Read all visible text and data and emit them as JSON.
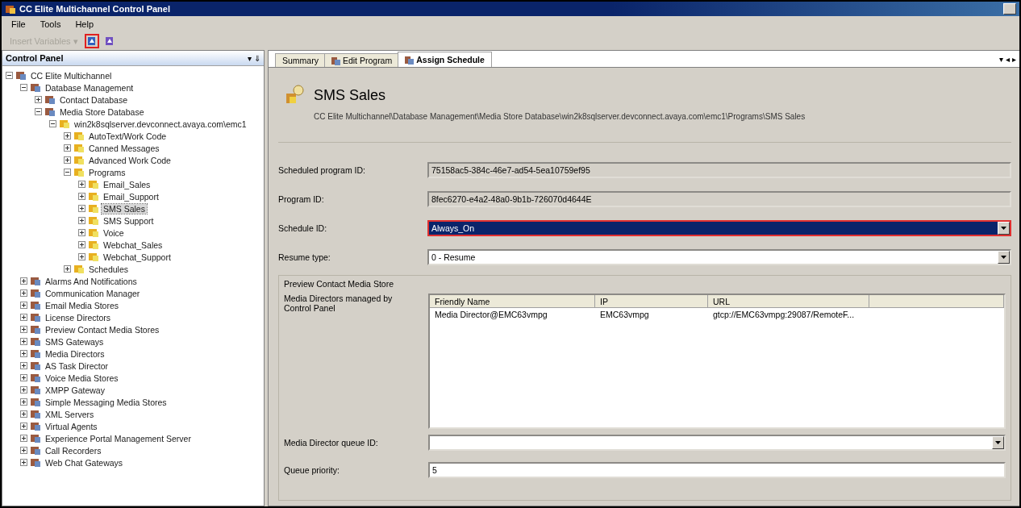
{
  "window": {
    "title": "CC Elite Multichannel Control Panel"
  },
  "menu": [
    "File",
    "Tools",
    "Help"
  ],
  "toolbar": {
    "insert_variables": {
      "label": "Insert Variables",
      "caret": "▾",
      "disabled": true
    },
    "icons": [
      {
        "highlighted": true
      },
      {
        "highlighted": false
      }
    ]
  },
  "tree_panel": {
    "title": "Control Panel",
    "pin": "▾ ⇓"
  },
  "tree": [
    {
      "label": "CC Elite Multichannel",
      "expanded": true,
      "selected": false,
      "children": [
        {
          "label": "Database Management",
          "expanded": true,
          "selected": false,
          "children": [
            {
              "label": "Contact Database",
              "expanded": false,
              "selected": false
            },
            {
              "label": "Media Store Database",
              "expanded": true,
              "selected": false,
              "children": [
                {
                  "label": "win2k8sqlserver.devconnect.avaya.com\\emc1",
                  "expanded": true,
                  "selected": false,
                  "children": [
                    {
                      "label": "AutoText/Work Code",
                      "expanded": false,
                      "selected": false
                    },
                    {
                      "label": "Canned Messages",
                      "expanded": false,
                      "selected": false
                    },
                    {
                      "label": "Advanced Work Code",
                      "expanded": false,
                      "selected": false
                    },
                    {
                      "label": "Programs",
                      "expanded": true,
                      "selected": false,
                      "children": [
                        {
                          "label": "Email_Sales",
                          "expanded": false,
                          "selected": false
                        },
                        {
                          "label": "Email_Support",
                          "expanded": false,
                          "selected": false
                        },
                        {
                          "label": "SMS Sales",
                          "expanded": false,
                          "selected": true
                        },
                        {
                          "label": "SMS Support",
                          "expanded": false,
                          "selected": false
                        },
                        {
                          "label": "Voice",
                          "expanded": false,
                          "selected": false
                        },
                        {
                          "label": "Webchat_Sales",
                          "expanded": false,
                          "selected": false
                        },
                        {
                          "label": "Webchat_Support",
                          "expanded": false,
                          "selected": false
                        }
                      ]
                    },
                    {
                      "label": "Schedules",
                      "expanded": false,
                      "selected": false
                    }
                  ]
                }
              ]
            }
          ]
        },
        {
          "label": "Alarms And Notifications",
          "expanded": false,
          "selected": false
        },
        {
          "label": "Communication Manager",
          "expanded": false,
          "selected": false
        },
        {
          "label": "Email Media Stores",
          "expanded": false,
          "selected": false
        },
        {
          "label": "License Directors",
          "expanded": false,
          "selected": false
        },
        {
          "label": "Preview Contact Media Stores",
          "expanded": false,
          "selected": false
        },
        {
          "label": "SMS Gateways",
          "expanded": false,
          "selected": false
        },
        {
          "label": "Media Directors",
          "expanded": false,
          "selected": false
        },
        {
          "label": "AS Task Director",
          "expanded": false,
          "selected": false
        },
        {
          "label": "Voice Media Stores",
          "expanded": false,
          "selected": false
        },
        {
          "label": "XMPP Gateway",
          "expanded": false,
          "selected": false
        },
        {
          "label": "Simple Messaging Media Stores",
          "expanded": false,
          "selected": false
        },
        {
          "label": "XML Servers",
          "expanded": false,
          "selected": false
        },
        {
          "label": "Virtual Agents",
          "expanded": false,
          "selected": false
        },
        {
          "label": "Experience Portal Management Server",
          "expanded": false,
          "selected": false
        },
        {
          "label": "Call Recorders",
          "expanded": false,
          "selected": false
        },
        {
          "label": "Web Chat Gateways",
          "expanded": false,
          "selected": false
        }
      ]
    }
  ],
  "tabs": [
    {
      "label": "Summary",
      "selected": false,
      "icon": false
    },
    {
      "label": "Edit Program",
      "selected": false,
      "icon": true
    },
    {
      "label": "Assign Schedule",
      "selected": true,
      "icon": true
    }
  ],
  "tab_controls": "▾ ◂ ▸",
  "header": {
    "title": "SMS Sales",
    "path": "CC Elite Multichannel\\Database Management\\Media Store Database\\win2k8sqlserver.devconnect.avaya.com\\emc1\\Programs\\SMS Sales"
  },
  "fields": [
    {
      "label": "Scheduled program ID:",
      "kind": "readonly",
      "value": "75158ac5-384c-46e7-ad54-5ea10759ef95",
      "highlighted": false,
      "focused": false
    },
    {
      "label": "Program ID:",
      "kind": "readonly",
      "value": "8fec6270-e4a2-48a0-9b1b-726070d4644E",
      "highlighted": false,
      "focused": false
    },
    {
      "label": "Schedule ID:",
      "kind": "dropdown",
      "value": "Always_On",
      "highlighted": true,
      "focused": true
    },
    {
      "label": "Resume type:",
      "kind": "dropdown",
      "value": "0 - Resume",
      "highlighted": false,
      "focused": false
    }
  ],
  "group": {
    "title": "Preview Contact Media Store",
    "table_label": "Media Directors managed by Control Panel",
    "table": {
      "columns": [
        "Friendly Name",
        "IP",
        "URL"
      ],
      "rows": [
        [
          "Media Director@EMC63vmpg",
          "EMC63vmpg",
          "gtcp://EMC63vmpg:29087/RemoteF..."
        ]
      ]
    },
    "fields": [
      {
        "label": "Media Director queue ID:",
        "kind": "dropdown",
        "highlighted": false
      },
      {
        "label": "Queue priority:",
        "kind": "text",
        "value": "5",
        "highlighted": false,
        "focused": false
      }
    ]
  }
}
